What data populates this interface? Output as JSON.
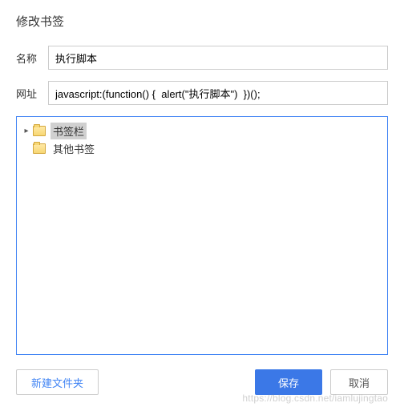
{
  "dialog": {
    "title": "修改书签"
  },
  "form": {
    "name_label": "名称",
    "name_value": "执行脚本",
    "url_label": "网址",
    "url_value": "javascript:(function() {  alert(\"执行脚本\")  })();"
  },
  "tree": {
    "items": [
      {
        "label": "书签栏",
        "expanded": true,
        "selected": true,
        "level": 0
      },
      {
        "label": "其他书签",
        "expanded": false,
        "selected": false,
        "level": 1
      }
    ]
  },
  "buttons": {
    "new_folder": "新建文件夹",
    "save": "保存",
    "cancel": "取消"
  },
  "watermark": "https://blog.csdn.net/iamlujingtao"
}
